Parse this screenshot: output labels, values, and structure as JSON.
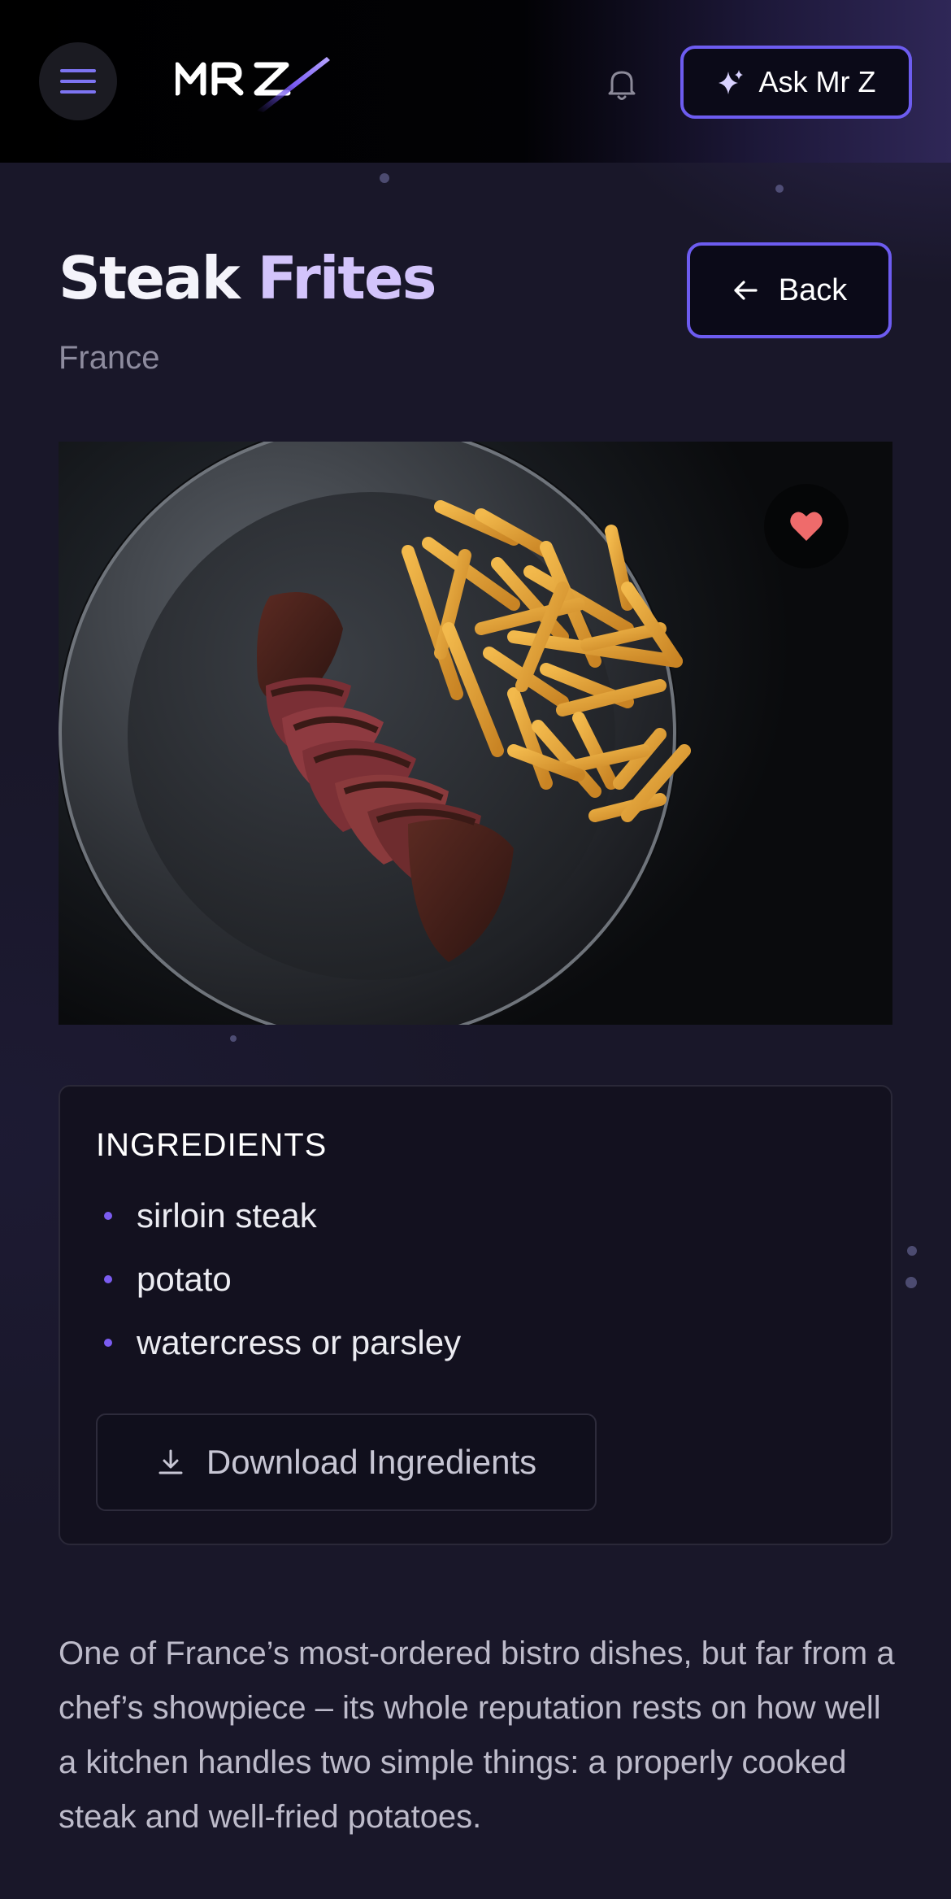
{
  "header": {
    "menu_icon": "hamburger-icon",
    "logo_text": "MRZ",
    "bell_icon": "bell-icon",
    "ask_label": "Ask Mr Z",
    "ask_icon": "sparkle-icon"
  },
  "recipe": {
    "title_word1": "Steak",
    "title_word2": "Frites",
    "country": "France",
    "back_label": "Back",
    "back_icon": "arrow-left-icon",
    "favorite_icon": "heart-icon",
    "favorited": true
  },
  "ingredients": {
    "heading": "INGREDIENTS",
    "items": [
      "sirloin steak",
      "potato",
      "watercress or parsley"
    ],
    "download_label": "Download Ingredients",
    "download_icon": "download-icon"
  },
  "description": "One of France’s most-ordered bistro dishes, but far from a chef’s showpiece – its whole reputation rests on how well a kitchen handles two simple things: a properly cooked steak and well-fried potatoes.",
  "colors": {
    "background": "#191729",
    "accent": "#6d5cf0",
    "title_highlight": "#d3c4fb",
    "heart": "#ef6b6b",
    "bullet": "#7b5cf0"
  }
}
